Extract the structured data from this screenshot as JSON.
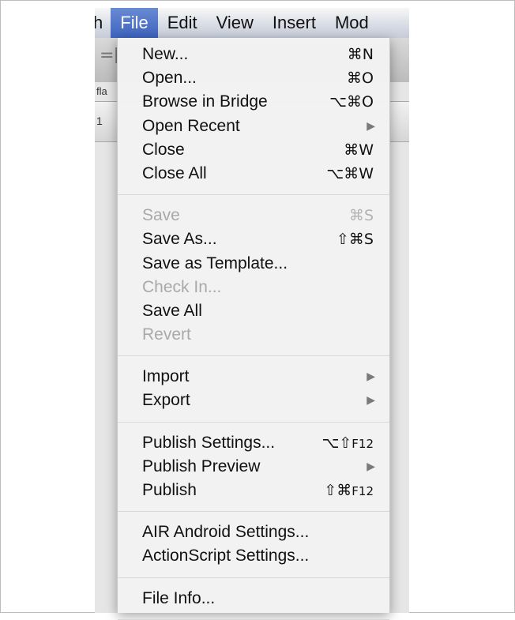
{
  "menubar": {
    "items": [
      {
        "label": "h"
      },
      {
        "label": "File"
      },
      {
        "label": "Edit"
      },
      {
        "label": "View"
      },
      {
        "label": "Insert"
      },
      {
        "label": "Mod"
      }
    ]
  },
  "background_window": {
    "toolbar_glyph": "=[",
    "file_label": "fla",
    "tab_mark": "1"
  },
  "file_menu": {
    "groups": [
      [
        {
          "label": "New...",
          "shortcut": "⌘N"
        },
        {
          "label": "Open...",
          "shortcut": "⌘O"
        },
        {
          "label": "Browse in Bridge",
          "shortcut": "⌥⌘O"
        },
        {
          "label": "Open Recent",
          "submenu": true
        },
        {
          "label": "Close",
          "shortcut": "⌘W"
        },
        {
          "label": "Close All",
          "shortcut": "⌥⌘W"
        }
      ],
      [
        {
          "label": "Save",
          "shortcut": "⌘S",
          "disabled": true
        },
        {
          "label": "Save As...",
          "shortcut": "⇧⌘S"
        },
        {
          "label": "Save as Template..."
        },
        {
          "label": "Check In...",
          "disabled": true
        },
        {
          "label": "Save All"
        },
        {
          "label": "Revert",
          "disabled": true
        }
      ],
      [
        {
          "label": "Import",
          "submenu": true
        },
        {
          "label": "Export",
          "submenu": true
        }
      ],
      [
        {
          "label": "Publish Settings...",
          "shortcut": "⌥⇧",
          "shortcut_small": "F12"
        },
        {
          "label": "Publish Preview",
          "submenu": true
        },
        {
          "label": "Publish",
          "shortcut": "⇧⌘",
          "shortcut_small": "F12"
        }
      ],
      [
        {
          "label": "AIR Android Settings..."
        },
        {
          "label": "ActionScript Settings..."
        }
      ],
      [
        {
          "label": "File Info..."
        }
      ]
    ]
  },
  "icons": {
    "submenu_arrow": "▶"
  }
}
